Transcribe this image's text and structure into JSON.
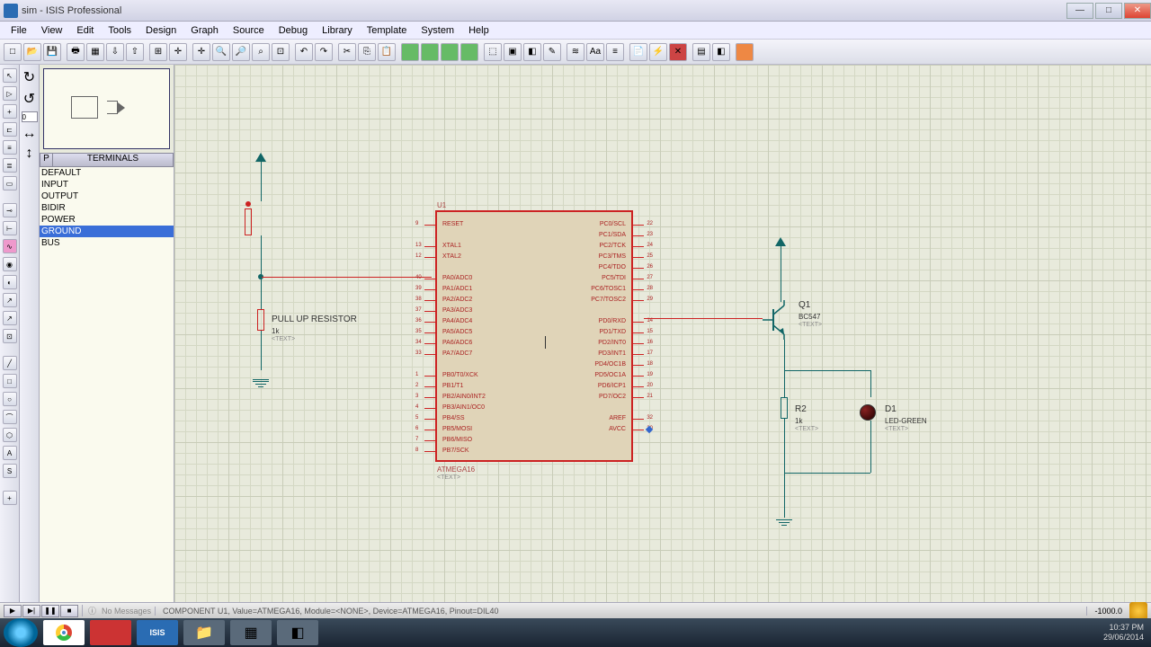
{
  "window": {
    "title": "sim - ISIS Professional"
  },
  "menu": [
    "File",
    "View",
    "Edit",
    "Tools",
    "Design",
    "Graph",
    "Source",
    "Debug",
    "Library",
    "Template",
    "System",
    "Help"
  ],
  "sidepanel": {
    "col_p": "P",
    "col_t": "TERMINALS",
    "items": [
      "DEFAULT",
      "INPUT",
      "OUTPUT",
      "BIDIR",
      "POWER",
      "GROUND",
      "BUS"
    ],
    "selected": 5
  },
  "schematic": {
    "pull_up_label": "PULL UP RESISTOR",
    "pull_up_val": "1k",
    "pull_up_text": "<TEXT>",
    "u1_ref": "U1",
    "u1_part": "ATMEGA16",
    "u1_text": "<TEXT>",
    "q1_ref": "Q1",
    "q1_part": "BC547",
    "q1_text": "<TEXT>",
    "r2_ref": "R2",
    "r2_val": "1k",
    "r2_text": "<TEXT>",
    "d1_ref": "D1",
    "d1_part": "LED-GREEN",
    "d1_text": "<TEXT>",
    "pins_left": [
      {
        "no": "9",
        "name": "RESET"
      },
      {
        "no": "13",
        "name": "XTAL1"
      },
      {
        "no": "12",
        "name": "XTAL2"
      },
      {
        "no": "40",
        "name": "PA0/ADC0"
      },
      {
        "no": "39",
        "name": "PA1/ADC1"
      },
      {
        "no": "38",
        "name": "PA2/ADC2"
      },
      {
        "no": "37",
        "name": "PA3/ADC3"
      },
      {
        "no": "36",
        "name": "PA4/ADC4"
      },
      {
        "no": "35",
        "name": "PA5/ADC5"
      },
      {
        "no": "34",
        "name": "PA6/ADC6"
      },
      {
        "no": "33",
        "name": "PA7/ADC7"
      },
      {
        "no": "1",
        "name": "PB0/T0/XCK"
      },
      {
        "no": "2",
        "name": "PB1/T1"
      },
      {
        "no": "3",
        "name": "PB2/AIN0/INT2"
      },
      {
        "no": "4",
        "name": "PB3/AIN1/OC0"
      },
      {
        "no": "5",
        "name": "PB4/SS"
      },
      {
        "no": "6",
        "name": "PB5/MOSI"
      },
      {
        "no": "7",
        "name": "PB6/MISO"
      },
      {
        "no": "8",
        "name": "PB7/SCK"
      }
    ],
    "pins_right": [
      {
        "no": "22",
        "name": "PC0/SCL"
      },
      {
        "no": "23",
        "name": "PC1/SDA"
      },
      {
        "no": "24",
        "name": "PC2/TCK"
      },
      {
        "no": "25",
        "name": "PC3/TMS"
      },
      {
        "no": "26",
        "name": "PC4/TDO"
      },
      {
        "no": "27",
        "name": "PC5/TDI"
      },
      {
        "no": "28",
        "name": "PC6/TOSC1"
      },
      {
        "no": "29",
        "name": "PC7/TOSC2"
      },
      {
        "no": "14",
        "name": "PD0/RXD"
      },
      {
        "no": "15",
        "name": "PD1/TXD"
      },
      {
        "no": "16",
        "name": "PD2/INT0"
      },
      {
        "no": "17",
        "name": "PD3/INT1"
      },
      {
        "no": "18",
        "name": "PD4/OC1B"
      },
      {
        "no": "19",
        "name": "PD5/OC1A"
      },
      {
        "no": "20",
        "name": "PD6/ICP1"
      },
      {
        "no": "21",
        "name": "PD7/OC2"
      },
      {
        "no": "32",
        "name": "AREF"
      },
      {
        "no": "30",
        "name": "AVCC"
      }
    ]
  },
  "status": {
    "nomsg": "No Messages",
    "info": "COMPONENT U1, Value=ATMEGA16, Module=<NONE>, Device=ATMEGA16, Pinout=DIL40",
    "coord": "-1000.0"
  },
  "taskbar": {
    "time": "10:37 PM",
    "date": "29/06/2014"
  }
}
